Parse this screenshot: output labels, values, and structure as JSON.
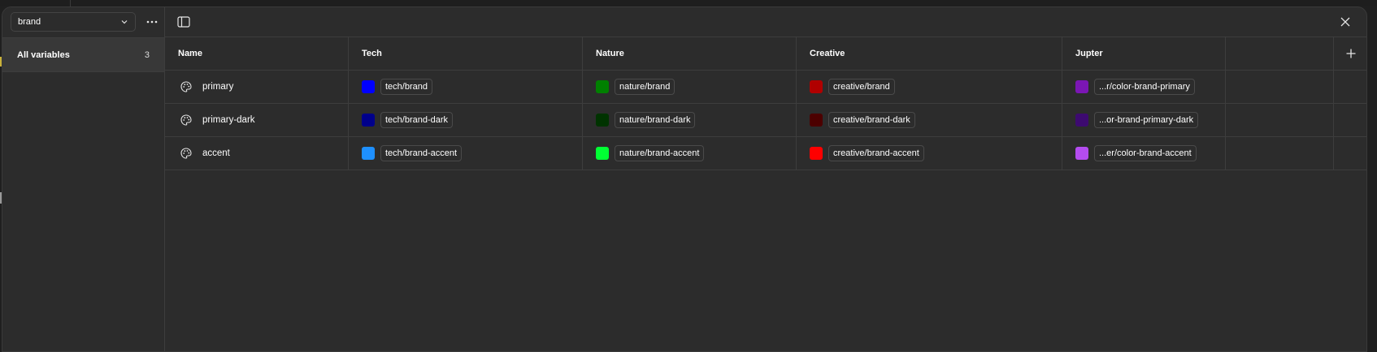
{
  "sidebar": {
    "collection_select": {
      "value": "brand"
    },
    "groups": [
      {
        "label": "All variables",
        "count": "3"
      }
    ]
  },
  "table": {
    "headers": [
      "Name",
      "Tech",
      "Nature",
      "Creative",
      "Jupter"
    ],
    "rows": [
      {
        "name": "primary",
        "values": [
          {
            "color": "#0000ff",
            "alias": "tech/brand"
          },
          {
            "color": "#008000",
            "alias": "nature/brand"
          },
          {
            "color": "#b00000",
            "alias": "creative/brand"
          },
          {
            "color": "#7b16b4",
            "alias": "...r/color-brand-primary"
          }
        ]
      },
      {
        "name": "primary-dark",
        "values": [
          {
            "color": "#00008b",
            "alias": "tech/brand-dark"
          },
          {
            "color": "#003300",
            "alias": "nature/brand-dark"
          },
          {
            "color": "#4c0000",
            "alias": "creative/brand-dark"
          },
          {
            "color": "#3d0a70",
            "alias": "...or-brand-primary-dark"
          }
        ]
      },
      {
        "name": "accent",
        "values": [
          {
            "color": "#1e90ff",
            "alias": "tech/brand-accent"
          },
          {
            "color": "#00ff33",
            "alias": "nature/brand-accent"
          },
          {
            "color": "#ff0000",
            "alias": "creative/brand-accent"
          },
          {
            "color": "#b44cf0",
            "alias": "...er/color-brand-accent"
          }
        ]
      }
    ]
  },
  "icons": {
    "variable_type": "palette-icon",
    "collection_chevron": "chevron-down-icon",
    "more": "more-horizontal-icon",
    "panel_toggle": "sidebar-toggle-icon",
    "close": "close-icon",
    "add_mode": "plus-icon"
  }
}
